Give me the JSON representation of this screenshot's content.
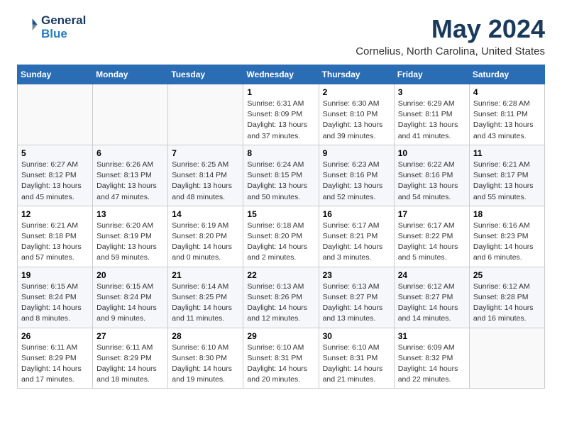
{
  "header": {
    "logo_line1": "General",
    "logo_line2": "Blue",
    "month": "May 2024",
    "location": "Cornelius, North Carolina, United States"
  },
  "weekdays": [
    "Sunday",
    "Monday",
    "Tuesday",
    "Wednesday",
    "Thursday",
    "Friday",
    "Saturday"
  ],
  "weeks": [
    [
      {
        "day": "",
        "info": ""
      },
      {
        "day": "",
        "info": ""
      },
      {
        "day": "",
        "info": ""
      },
      {
        "day": "1",
        "info": "Sunrise: 6:31 AM\nSunset: 8:09 PM\nDaylight: 13 hours\nand 37 minutes."
      },
      {
        "day": "2",
        "info": "Sunrise: 6:30 AM\nSunset: 8:10 PM\nDaylight: 13 hours\nand 39 minutes."
      },
      {
        "day": "3",
        "info": "Sunrise: 6:29 AM\nSunset: 8:11 PM\nDaylight: 13 hours\nand 41 minutes."
      },
      {
        "day": "4",
        "info": "Sunrise: 6:28 AM\nSunset: 8:11 PM\nDaylight: 13 hours\nand 43 minutes."
      }
    ],
    [
      {
        "day": "5",
        "info": "Sunrise: 6:27 AM\nSunset: 8:12 PM\nDaylight: 13 hours\nand 45 minutes."
      },
      {
        "day": "6",
        "info": "Sunrise: 6:26 AM\nSunset: 8:13 PM\nDaylight: 13 hours\nand 47 minutes."
      },
      {
        "day": "7",
        "info": "Sunrise: 6:25 AM\nSunset: 8:14 PM\nDaylight: 13 hours\nand 48 minutes."
      },
      {
        "day": "8",
        "info": "Sunrise: 6:24 AM\nSunset: 8:15 PM\nDaylight: 13 hours\nand 50 minutes."
      },
      {
        "day": "9",
        "info": "Sunrise: 6:23 AM\nSunset: 8:16 PM\nDaylight: 13 hours\nand 52 minutes."
      },
      {
        "day": "10",
        "info": "Sunrise: 6:22 AM\nSunset: 8:16 PM\nDaylight: 13 hours\nand 54 minutes."
      },
      {
        "day": "11",
        "info": "Sunrise: 6:21 AM\nSunset: 8:17 PM\nDaylight: 13 hours\nand 55 minutes."
      }
    ],
    [
      {
        "day": "12",
        "info": "Sunrise: 6:21 AM\nSunset: 8:18 PM\nDaylight: 13 hours\nand 57 minutes."
      },
      {
        "day": "13",
        "info": "Sunrise: 6:20 AM\nSunset: 8:19 PM\nDaylight: 13 hours\nand 59 minutes."
      },
      {
        "day": "14",
        "info": "Sunrise: 6:19 AM\nSunset: 8:20 PM\nDaylight: 14 hours\nand 0 minutes."
      },
      {
        "day": "15",
        "info": "Sunrise: 6:18 AM\nSunset: 8:20 PM\nDaylight: 14 hours\nand 2 minutes."
      },
      {
        "day": "16",
        "info": "Sunrise: 6:17 AM\nSunset: 8:21 PM\nDaylight: 14 hours\nand 3 minutes."
      },
      {
        "day": "17",
        "info": "Sunrise: 6:17 AM\nSunset: 8:22 PM\nDaylight: 14 hours\nand 5 minutes."
      },
      {
        "day": "18",
        "info": "Sunrise: 6:16 AM\nSunset: 8:23 PM\nDaylight: 14 hours\nand 6 minutes."
      }
    ],
    [
      {
        "day": "19",
        "info": "Sunrise: 6:15 AM\nSunset: 8:24 PM\nDaylight: 14 hours\nand 8 minutes."
      },
      {
        "day": "20",
        "info": "Sunrise: 6:15 AM\nSunset: 8:24 PM\nDaylight: 14 hours\nand 9 minutes."
      },
      {
        "day": "21",
        "info": "Sunrise: 6:14 AM\nSunset: 8:25 PM\nDaylight: 14 hours\nand 11 minutes."
      },
      {
        "day": "22",
        "info": "Sunrise: 6:13 AM\nSunset: 8:26 PM\nDaylight: 14 hours\nand 12 minutes."
      },
      {
        "day": "23",
        "info": "Sunrise: 6:13 AM\nSunset: 8:27 PM\nDaylight: 14 hours\nand 13 minutes."
      },
      {
        "day": "24",
        "info": "Sunrise: 6:12 AM\nSunset: 8:27 PM\nDaylight: 14 hours\nand 14 minutes."
      },
      {
        "day": "25",
        "info": "Sunrise: 6:12 AM\nSunset: 8:28 PM\nDaylight: 14 hours\nand 16 minutes."
      }
    ],
    [
      {
        "day": "26",
        "info": "Sunrise: 6:11 AM\nSunset: 8:29 PM\nDaylight: 14 hours\nand 17 minutes."
      },
      {
        "day": "27",
        "info": "Sunrise: 6:11 AM\nSunset: 8:29 PM\nDaylight: 14 hours\nand 18 minutes."
      },
      {
        "day": "28",
        "info": "Sunrise: 6:10 AM\nSunset: 8:30 PM\nDaylight: 14 hours\nand 19 minutes."
      },
      {
        "day": "29",
        "info": "Sunrise: 6:10 AM\nSunset: 8:31 PM\nDaylight: 14 hours\nand 20 minutes."
      },
      {
        "day": "30",
        "info": "Sunrise: 6:10 AM\nSunset: 8:31 PM\nDaylight: 14 hours\nand 21 minutes."
      },
      {
        "day": "31",
        "info": "Sunrise: 6:09 AM\nSunset: 8:32 PM\nDaylight: 14 hours\nand 22 minutes."
      },
      {
        "day": "",
        "info": ""
      }
    ]
  ]
}
